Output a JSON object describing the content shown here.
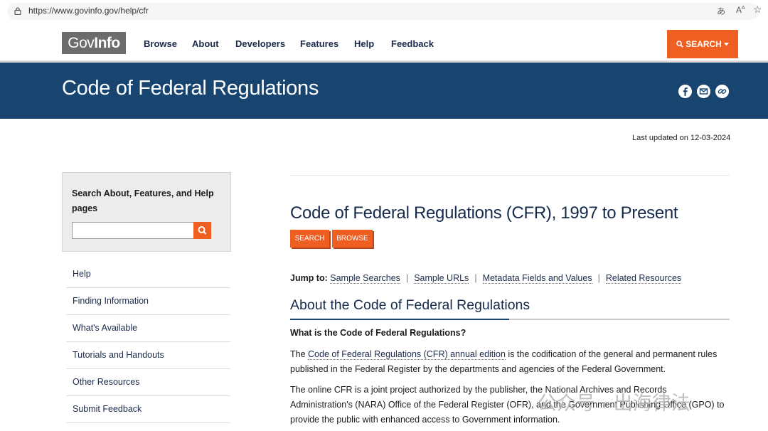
{
  "browser": {
    "url": "https://www.govinfo.gov/help/cfr",
    "read_aloud_icon": "read-aloud-icon",
    "text_size_icon": "text-size-icon",
    "favorite_icon": "star-icon"
  },
  "header": {
    "logo_left": "Gov",
    "logo_right": "Info",
    "nav": [
      "Browse",
      "About",
      "Developers",
      "Features",
      "Help",
      "Feedback"
    ],
    "search_label": "SEARCH",
    "accent": "#f05f22"
  },
  "banner": {
    "title": "Code of Federal Regulations",
    "background": "#184470",
    "share_icons": [
      "facebook-icon",
      "email-icon",
      "link-icon"
    ]
  },
  "last_updated": "Last updated on 12-03-2024",
  "sidebar": {
    "search_label": "Search About, Features, and Help pages",
    "search_value": "",
    "items": [
      "Help",
      "Finding Information",
      "What's Available",
      "Tutorials and Handouts",
      "Other Resources",
      "Submit Feedback"
    ]
  },
  "main": {
    "title": "Code of Federal Regulations (CFR), 1997 to Present",
    "buttons": [
      "SEARCH",
      "BROWSE"
    ],
    "jump_label": "Jump to:",
    "jump_links": [
      "Sample Searches",
      "Sample URLs",
      "Metadata Fields and Values",
      "Related Resources"
    ],
    "section_title": "About the Code of Federal Regulations",
    "question": "What is the Code of Federal Regulations?",
    "p1_prefix": "The ",
    "p1_link": "Code of Federal Regulations (CFR) annual edition",
    "p1_rest": " is the codification of the general and permanent rules published in the Federal Register by the departments and agencies of the Federal Government.",
    "p2": "The online CFR is a joint project authorized by the publisher, the National Archives and Records Administration's (NARA) Office of the Federal Register (OFR), and the Government Publishing Office (GPO) to provide the public with enhanced access to Government information."
  },
  "watermark": "公众号 · 出海律法"
}
